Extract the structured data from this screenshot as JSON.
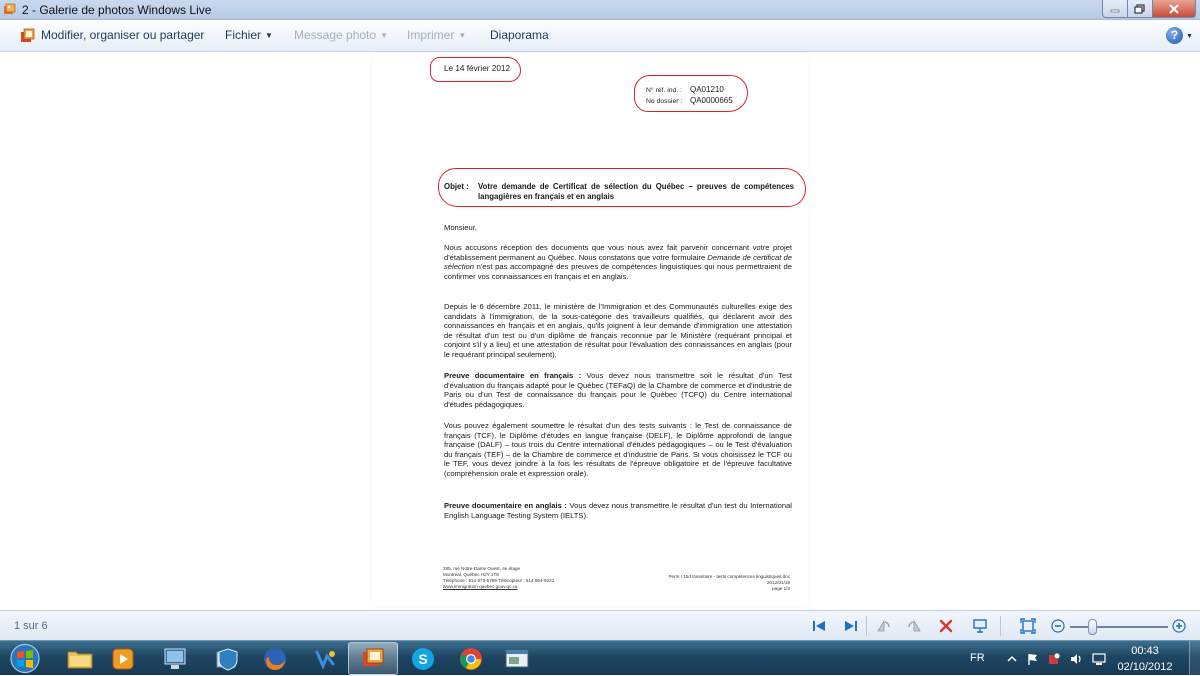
{
  "window": {
    "title": "2 - Galerie de photos Windows Live"
  },
  "toolbar": {
    "organize": "Modifier, organiser ou partager",
    "file": "Fichier",
    "email": "Message photo",
    "print": "Imprimer",
    "slideshow": "Diaporama"
  },
  "document": {
    "date": "Le 14 février 2012",
    "ref_label": "N° réf. ind. :",
    "ref_value": "QA01210",
    "file_label": "No dossier :",
    "file_value": "QA0000665",
    "subject_label": "Objet :",
    "subject_text": "Votre demande de Certificat de sélection du Québec – preuves de compétences langagières en français et en anglais",
    "salutation": "Monsieur,",
    "p1_a": "Nous accusons réception des documents que vous nous avez fait parvenir concernant votre projet d'établissement permanent au Québec. Nous constatons que votre formulaire ",
    "p1_em": "Demande de certificat de sélection",
    "p1_b": " n'est pas accompagné des preuves de compétences linguistiques qui nous permettraient de confirmer vos connaissances en français et en anglais.",
    "p2": "Depuis le 6 décembre 2011, le ministère de l'Immigration et des Communautés culturelles exige des candidats à l'immigration, de la sous-catégorie des travailleurs qualifiés, qui déclarent avoir des connaissances en français et en anglais, qu'ils joignent à leur demande d'immigration une attestation de résultat d'un test ou d'un diplôme de français reconnue par le Ministère (requérant principal et conjoint s'il y a lieu) et une attestation de résultat pour l'évaluation des connaissances en anglais (pour le requérant principal seulement).",
    "p3_bold": "Preuve documentaire en français :",
    "p3": " Vous devez nous transmettre soit le résultat d'un Test d'évaluation du français adapté pour le Québec (TEFaQ) de la Chambre de commerce et d'industrie de Paris ou d'un Test de connaissance du français pour le Québec (TCFQ) du Centre international d'études pédagogiques.",
    "p4": "Vous pouvez également soumettre le résultat d'un des tests suivants : le Test de connaissance de français (TCF), le Diplôme d'études en langue française (DELF), le Diplôme approfondi de langue française (DALF) – tous trois du Centre international d'études pédagogiques – ou le Test d'évaluation du français (TEF) – de la Chambre de commerce et d'industrie de Paris. Si vous choisissez le TCF ou le TEF, vous devez joindre à la fois les résultats de l'épreuve obligatoire et de l'épreuve facultative (compréhension orale et expression orale).",
    "p5_bold": "Preuve documentaire en anglais :",
    "p5": " Vous devez nous transmettre le résultat d'un test du International English Language Testing System (IELTS).",
    "footer_left_1": "285, rue Notre-Dame Ouest, 4e étage",
    "footer_left_2": "Montréal, Québec H2Y 1T8",
    "footer_left_3": "Téléphone : 514 873-5789  Télécopieur : 514 864-9221",
    "footer_left_4": "www.immigration-quebec.gouv.qc.ca",
    "footer_right_1": "Perm I 15d transitoire - tests compétences linguistiques.doc",
    "footer_right_2": "2012/01/19",
    "footer_right_3": "page 1/3"
  },
  "viewer": {
    "page_count": "1 sur 6"
  },
  "taskbar": {
    "language": "FR",
    "time": "00:43",
    "date": "02/10/2012"
  },
  "colors": {
    "annotation_red": "#d6262a",
    "taskbar_blue": "#1e4663",
    "toolbar_text": "#1e395b"
  }
}
